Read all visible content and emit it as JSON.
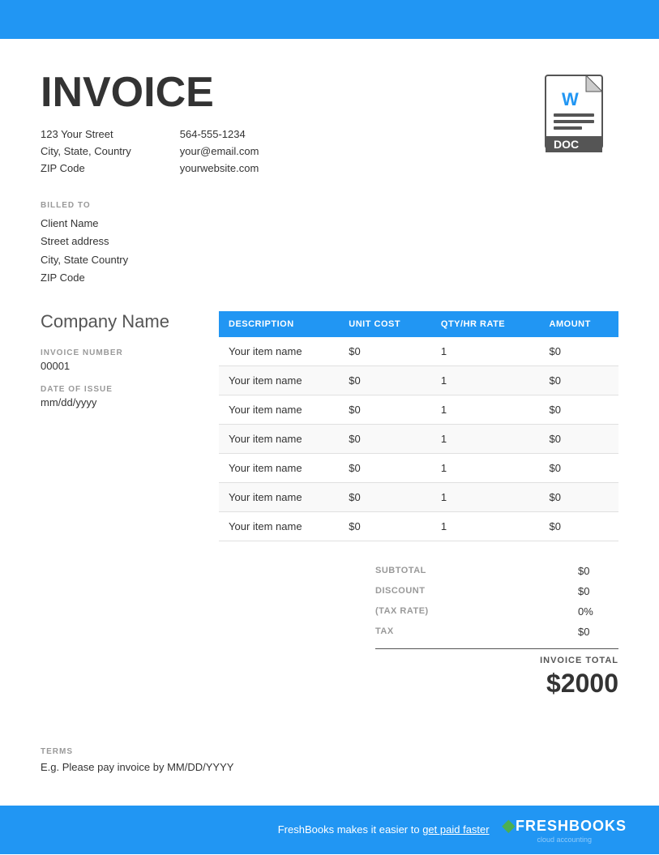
{
  "top_bar": {
    "color": "#2196F3"
  },
  "invoice": {
    "title": "INVOICE",
    "address": {
      "street": "123 Your Street",
      "city_state": "City, State, Country",
      "zip": "ZIP Code"
    },
    "contact": {
      "phone": "564-555-1234",
      "email": "your@email.com",
      "website": "yourwebsite.com"
    },
    "billed_to_label": "BILLED TO",
    "billed_to": {
      "name": "Client Name",
      "street": "Street address",
      "city_state": "City, State Country",
      "zip": "ZIP Code"
    },
    "company_name": "Company Name",
    "invoice_number_label": "INVOICE NUMBER",
    "invoice_number": "00001",
    "date_of_issue_label": "DATE OF ISSUE",
    "date_of_issue": "mm/dd/yyyy"
  },
  "table": {
    "headers": [
      "DESCRIPTION",
      "UNIT COST",
      "QTY/HR RATE",
      "AMOUNT"
    ],
    "rows": [
      {
        "description": "Your item name",
        "unit_cost": "$0",
        "qty": "1",
        "amount": "$0"
      },
      {
        "description": "Your item name",
        "unit_cost": "$0",
        "qty": "1",
        "amount": "$0"
      },
      {
        "description": "Your item name",
        "unit_cost": "$0",
        "qty": "1",
        "amount": "$0"
      },
      {
        "description": "Your item name",
        "unit_cost": "$0",
        "qty": "1",
        "amount": "$0"
      },
      {
        "description": "Your item name",
        "unit_cost": "$0",
        "qty": "1",
        "amount": "$0"
      },
      {
        "description": "Your item name",
        "unit_cost": "$0",
        "qty": "1",
        "amount": "$0"
      },
      {
        "description": "Your item name",
        "unit_cost": "$0",
        "qty": "1",
        "amount": "$0"
      }
    ]
  },
  "totals": {
    "subtotal_label": "SUBTOTAL",
    "subtotal_value": "$0",
    "discount_label": "DISCOUNT",
    "discount_value": "$0",
    "tax_rate_label": "(TAX RATE)",
    "tax_rate_value": "0%",
    "tax_label": "TAX",
    "tax_value": "$0",
    "invoice_total_label": "INVOICE TOTAL",
    "invoice_total_value": "$2000"
  },
  "terms": {
    "label": "TERMS",
    "text": "E.g. Please pay invoice by MM/DD/YYYY"
  },
  "footer": {
    "text": "FreshBooks makes it easier to ",
    "link": "get paid faster",
    "brand": "FRESHBOOKS",
    "brand_sub": "cloud accounting"
  }
}
